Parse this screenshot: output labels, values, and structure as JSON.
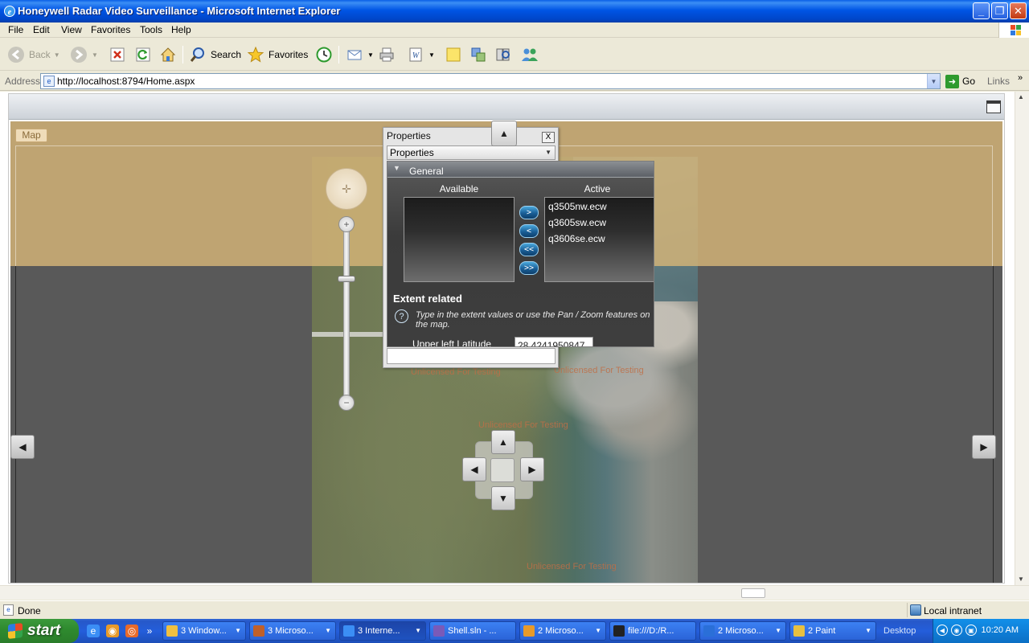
{
  "window": {
    "title": "Honeywell Radar Video Surveillance - Microsoft Internet Explorer",
    "minimize_glyph": "_",
    "maximize_glyph": "❐",
    "close_glyph": "✕"
  },
  "menu": [
    "File",
    "Edit",
    "View",
    "Favorites",
    "Tools",
    "Help"
  ],
  "toolbar": {
    "back_label": "Back",
    "search_label": "Search",
    "favorites_label": "Favorites"
  },
  "address": {
    "label": "Address",
    "url": "http://localhost:8794/Home.aspx",
    "go_label": "Go",
    "links_label": "Links"
  },
  "app": {
    "tab_label": "Map",
    "overlay_labels": [
      "Unlicensed For Testing",
      "Unlicensed For Testing",
      "Unlicensed For Testing",
      "Unlicensed For Testing"
    ]
  },
  "properties": {
    "window_title": "Properties",
    "close_glyph": "X",
    "dropdown_value": "Properties",
    "section_title": "General",
    "available_header": "Available",
    "active_header": "Active",
    "available_items": [],
    "active_items": [
      "q3505nw.ecw",
      "q3605sw.ecw",
      "q3606se.ecw"
    ],
    "buttons": [
      ">",
      "<",
      "<<",
      ">>"
    ],
    "extent_title": "Extent related",
    "help_glyph": "?",
    "help_text": "Type in the extent values or use the Pan / Zoom features on the map.",
    "upper_left_latitude_label": "Upper left Latitude",
    "upper_left_latitude_value": "28.4241950847"
  },
  "status": {
    "text": "Done",
    "zone": "Local intranet"
  },
  "taskbar": {
    "start_label": "start",
    "tasks": [
      {
        "label": "3 Window...",
        "color": "#f0c040",
        "active": false
      },
      {
        "label": "3 Microso...",
        "color": "#c0602a",
        "active": false
      },
      {
        "label": "3 Interne...",
        "color": "#3b8ef5",
        "active": true
      },
      {
        "label": "Shell.sln - ...",
        "color": "#7a5ab8",
        "active": false
      },
      {
        "label": "2 Microso...",
        "color": "#e89a2a",
        "active": false
      },
      {
        "label": "file:///D:/R...",
        "color": "#222222",
        "active": false
      },
      {
        "label": "2 Microso...",
        "color": "#2a6fd8",
        "active": false
      },
      {
        "label": "2 Paint",
        "color": "#e8c040",
        "active": false
      }
    ],
    "desktop_label": "Desktop",
    "clock": "10:20 AM"
  },
  "colors": {
    "accent_blue": "#0055e5",
    "map_overlay_tan": "#d6b478",
    "panel_dark": "#3e3e3e",
    "button_blue": "#1a5f97"
  }
}
